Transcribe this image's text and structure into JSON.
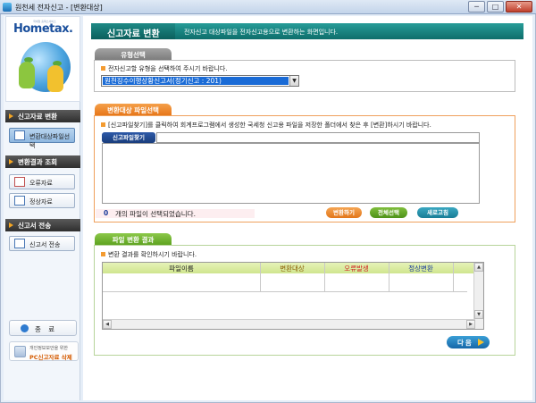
{
  "window": {
    "title": "원천세 전자신고 - [변환대상]",
    "btn_min": "─",
    "btn_max": "□",
    "btn_close": "✕"
  },
  "logo": {
    "text": "Hometax.",
    "sub": "국세청 홈택스서비스"
  },
  "sidebar": {
    "sections": [
      {
        "label": "신고자료 변환"
      },
      {
        "label": "변환결과 조회"
      },
      {
        "label": "신고서 전송"
      }
    ],
    "buttons": [
      {
        "label": "변환대상파일선택"
      },
      {
        "label": "오류자료"
      },
      {
        "label": "정상자료"
      },
      {
        "label": "신고서 전송"
      }
    ],
    "exit_label": "종 료",
    "pc_line1": "개인정보보안을 위한",
    "pc_line2": "PC신고자료 삭제"
  },
  "header": {
    "title": "신고자료 변환",
    "description": "전자신고 대상파일을 전자신고용으로 변환하는 화면입니다."
  },
  "type_section": {
    "tab": "유형선택",
    "hint": "전자신고할 유형을 선택하여 주시기 바랍니다.",
    "selected": "원천징수이행상황신고서(정기신고 : 201)"
  },
  "file_section": {
    "tab": "변환대상 파일선택",
    "hint": "[신고파일찾기]를 클릭하여 회계프로그램에서 생성한 국세청 신고용 파일을 저장한 폴더에서 찾은 후 [변환]하시기 바랍니다.",
    "find_button": "신고파일찾기",
    "path_value": "",
    "count": "0",
    "count_label": "개의 파일이 선택되었습니다.",
    "convert_button": "변환하기",
    "select_all_button": "전체선택",
    "refresh_button": "새로고침"
  },
  "result_section": {
    "tab": "파일 변환 결과",
    "hint": "변환 결과를 확인하시기 바랍니다.",
    "columns": [
      "파일이름",
      "변환대상",
      "오류발생",
      "정상변환"
    ],
    "column_colors": [
      "#333333",
      "#8a5a00",
      "#d02020",
      "#1a3a9a"
    ]
  },
  "next_button": "다음"
}
